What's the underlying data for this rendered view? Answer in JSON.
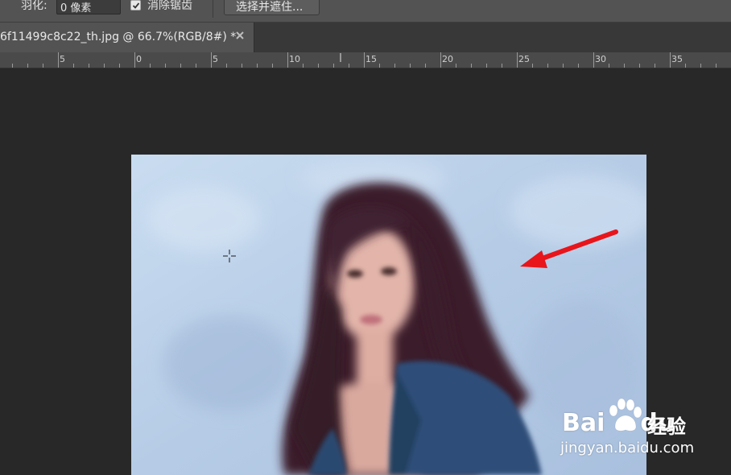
{
  "options_bar": {
    "feather_label": "羽化:",
    "feather_value": "0 像素",
    "antialias_checked": true,
    "antialias_label": "消除锯齿",
    "select_mask_label": "选择并遮住..."
  },
  "document_tab": {
    "title": "6f11499c8c22_th.jpg @ 66.7%(RGB/8#) *",
    "close_icon": "close-icon"
  },
  "ruler": {
    "labels": [
      "5",
      "0",
      "5",
      "10",
      "15",
      "20",
      "25",
      "30",
      "35"
    ]
  },
  "canvas": {
    "background": "#282828",
    "image_description_icons": [
      "crosshair-cursor-icon",
      "red-arrow-icon"
    ],
    "arrow_color": "#e8151b"
  },
  "watermark": {
    "brand": "Bai",
    "brand_suffix": "du",
    "product": "经验",
    "url": "jingyan.baidu.com"
  }
}
